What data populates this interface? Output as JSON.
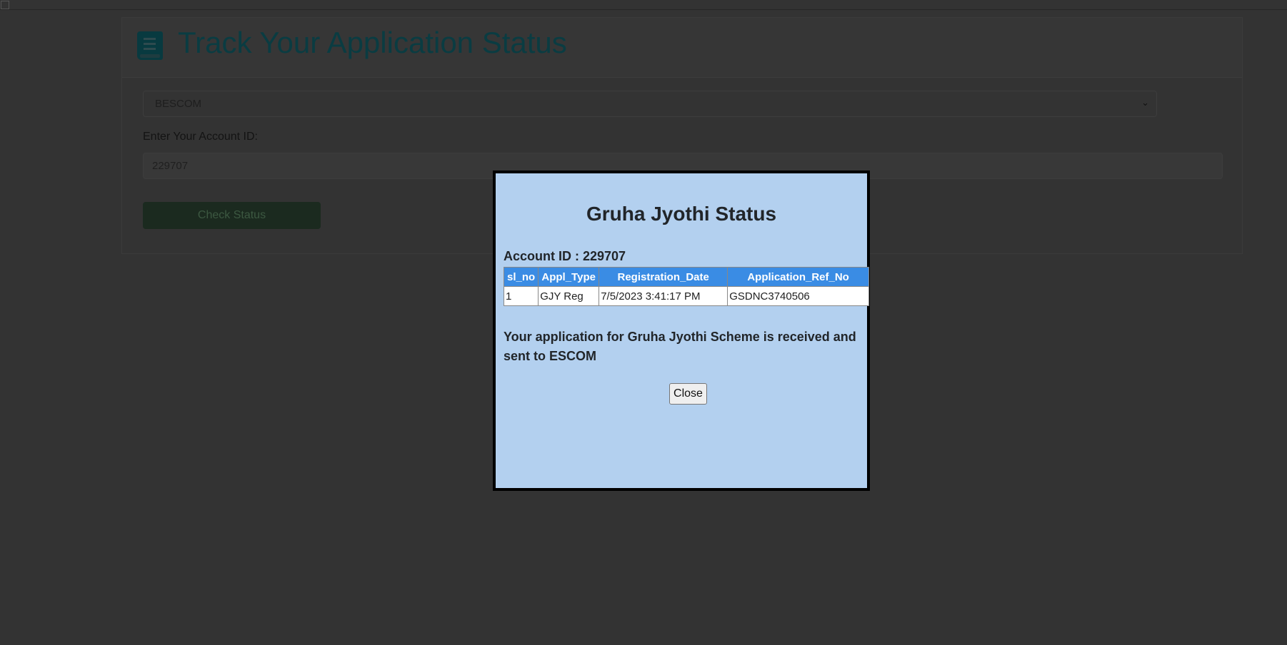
{
  "page": {
    "title": "Track Your Application Status",
    "title_icon": "book-icon",
    "escom_select": {
      "selected": "BESCOM"
    },
    "account_label": "Enter Your Account ID:",
    "account_value": "229707",
    "check_button": "Check Status"
  },
  "modal": {
    "title": "Gruha Jyothi Status",
    "account_line": "Account ID : 229707",
    "table": {
      "headers": [
        "sl_no",
        "Appl_Type",
        "Registration_Date",
        "Application_Ref_No"
      ],
      "rows": [
        [
          "1",
          "GJY Reg",
          "7/5/2023 3:41:17 PM",
          "GSDNC3740506"
        ]
      ]
    },
    "message": "Your application for Gruha Jyothi Scheme is received and sent to ESCOM",
    "close_button": "Close"
  },
  "colors": {
    "modal_bg": "#b3d0ef",
    "table_header": "#3a8ce4",
    "title": "#0a3c42"
  }
}
